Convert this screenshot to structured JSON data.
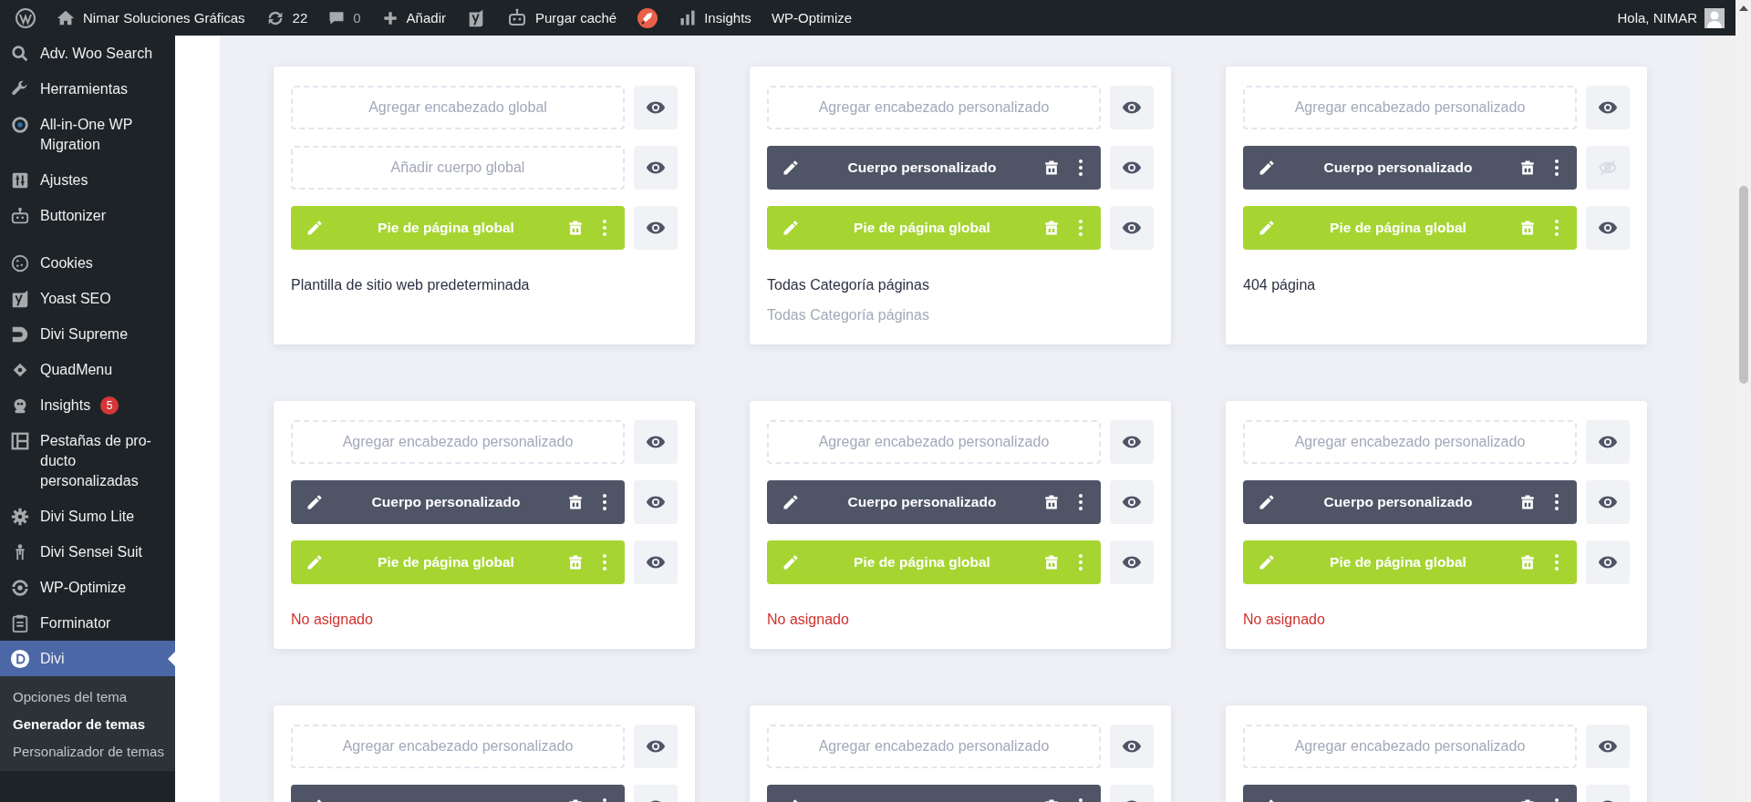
{
  "admin_bar": {
    "items": [
      {
        "kind": "logo"
      },
      {
        "kind": "home",
        "label": "Nimar Soluciones Gráficas"
      },
      {
        "kind": "updates",
        "label": "22"
      },
      {
        "kind": "comments",
        "label": "0"
      },
      {
        "kind": "new",
        "label": "Añadir"
      },
      {
        "kind": "seo"
      },
      {
        "kind": "cache",
        "label": "Purgar caché"
      },
      {
        "kind": "rocket"
      },
      {
        "kind": "stats",
        "label": "Insights"
      },
      {
        "kind": "text",
        "label": "WP-Optimize"
      }
    ],
    "account": {
      "greeting": "Hola, NIMAR"
    }
  },
  "sidebar": {
    "groups": [
      [
        {
          "label": "Adv. Woo Search",
          "selected": false
        },
        {
          "label": "Herramientas",
          "selected": false
        },
        {
          "label": "All-in-One WP Migration",
          "selected": false
        },
        {
          "label": "Ajustes",
          "selected": false
        },
        {
          "label": "Buttonizer",
          "selected": false
        }
      ],
      [
        {
          "label": "Cookies",
          "selected": false
        },
        {
          "label": "Yoast SEO",
          "selected": false
        },
        {
          "label": "Divi Supreme",
          "selected": false
        },
        {
          "label": "QuadMenu",
          "selected": false
        },
        {
          "label": "Insights",
          "badge": "5",
          "selected": false
        },
        {
          "label": "Pestañas de pro-ducto personalizadas",
          "selected": false
        },
        {
          "label": "Divi Sumo Lite",
          "selected": false
        },
        {
          "label": "Divi Sensei Suit",
          "selected": false
        },
        {
          "label": "WP-Optimize",
          "selected": false
        },
        {
          "label": "Forminator",
          "selected": false
        },
        {
          "label": "Divi",
          "selected": true,
          "children": [
            {
              "label": "Opciones del tema",
              "selected": false
            },
            {
              "label": "Generador de temas",
              "selected": true
            },
            {
              "label": "Personalizador de temas",
              "selected": false
            }
          ]
        }
      ]
    ]
  },
  "templates": [
    {
      "slots": [
        {
          "kind": "empty",
          "label": "Agregar encabezado global",
          "visible": true
        },
        {
          "kind": "empty",
          "label": "Añadir cuerpo global",
          "visible": true
        },
        {
          "kind": "global",
          "label": "Pie de página global",
          "visible": true
        }
      ],
      "assignments": [
        {
          "kind": "primary",
          "text": "Plantilla de sitio web predeterminada"
        }
      ]
    },
    {
      "slots": [
        {
          "kind": "empty",
          "label": "Agregar encabezado personalizado",
          "visible": true
        },
        {
          "kind": "custom",
          "label": "Cuerpo personalizado",
          "visible": true
        },
        {
          "kind": "global",
          "label": "Pie de página global",
          "visible": true
        }
      ],
      "assignments": [
        {
          "kind": "primary",
          "text": "Todas Categoría páginas"
        },
        {
          "kind": "secondary",
          "text": "Todas Categoría páginas"
        }
      ]
    },
    {
      "slots": [
        {
          "kind": "empty",
          "label": "Agregar encabezado personalizado",
          "visible": true
        },
        {
          "kind": "custom",
          "label": "Cuerpo personalizado",
          "visible": false
        },
        {
          "kind": "global",
          "label": "Pie de página global",
          "visible": true
        }
      ],
      "assignments": [
        {
          "kind": "primary",
          "text": "404 página"
        }
      ]
    },
    {
      "slots": [
        {
          "kind": "empty",
          "label": "Agregar encabezado personalizado",
          "visible": true
        },
        {
          "kind": "custom",
          "label": "Cuerpo personalizado",
          "visible": true
        },
        {
          "kind": "global",
          "label": "Pie de página global",
          "visible": true
        }
      ],
      "assignments": [
        {
          "kind": "unassigned",
          "text": "No asignado"
        }
      ]
    },
    {
      "slots": [
        {
          "kind": "empty",
          "label": "Agregar encabezado personalizado",
          "visible": true
        },
        {
          "kind": "custom",
          "label": "Cuerpo personalizado",
          "visible": true
        },
        {
          "kind": "global",
          "label": "Pie de página global",
          "visible": true
        }
      ],
      "assignments": [
        {
          "kind": "unassigned",
          "text": "No asignado"
        }
      ]
    },
    {
      "slots": [
        {
          "kind": "empty",
          "label": "Agregar encabezado personalizado",
          "visible": true
        },
        {
          "kind": "custom",
          "label": "Cuerpo personalizado",
          "visible": true
        },
        {
          "kind": "global",
          "label": "Pie de página global",
          "visible": true
        }
      ],
      "assignments": [
        {
          "kind": "unassigned",
          "text": "No asignado"
        }
      ]
    },
    {
      "slots": [
        {
          "kind": "empty",
          "label": "Agregar encabezado personalizado",
          "visible": true
        },
        {
          "kind": "custom",
          "visible": true
        }
      ]
    },
    {
      "slots": [
        {
          "kind": "empty",
          "label": "Agregar encabezado personalizado",
          "visible": true
        },
        {
          "kind": "custom",
          "visible": true
        }
      ]
    },
    {
      "slots": [
        {
          "kind": "empty",
          "label": "Agregar encabezado personalizado",
          "visible": true
        },
        {
          "kind": "custom",
          "visible": true
        }
      ]
    }
  ]
}
